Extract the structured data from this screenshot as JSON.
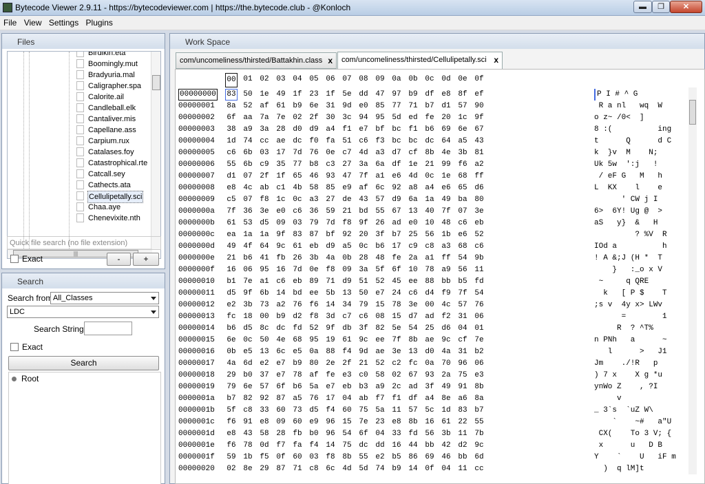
{
  "window": {
    "title": "Bytecode Viewer 2.9.11 - https://bytecodeviewer.com | https://the.bytecode.club - @Konloch",
    "min_glyph": "▬",
    "max_glyph": "❐",
    "close_glyph": "✕"
  },
  "menu": [
    "File",
    "View",
    "Settings",
    "Plugins"
  ],
  "files_panel": {
    "title": "Files",
    "items": [
      "Birdikin.eta",
      "Boomingly.mut",
      "Bradyuria.mal",
      "Caligrapher.spa",
      "Calorite.ail",
      "Candleball.elk",
      "Cantaliver.mis",
      "Capellane.ass",
      "Carpium.rux",
      "Catalases.foy",
      "Catastrophical.rte",
      "Catcall.sey",
      "Cathects.ata",
      "Cellulipetally.sci",
      "Chaa.aye",
      "Chenevixite.nth"
    ],
    "selected_index": 13,
    "hscroll_grip": "|||",
    "quick_search_placeholder": "Quick file search (no file extension)",
    "exact_label": "Exact",
    "minus_label": "-",
    "plus_label": "+"
  },
  "search_panel": {
    "title": "Search",
    "search_from_label": "Search from",
    "search_from_value": "All_Classes",
    "type_value": "LDC",
    "search_string_label": "Search String:",
    "exact_label": "Exact",
    "search_button": "Search",
    "root_label": "Root"
  },
  "workspace": {
    "title": "Work Space",
    "tabs": [
      {
        "label": "com/uncomeliness/thirsted/Battakhin.class",
        "close": "x"
      },
      {
        "label": "com/uncomeliness/thirsted/Cellulipetally.sci",
        "close": "x"
      }
    ],
    "active_tab": 1
  },
  "hex": {
    "header": [
      "00",
      "01",
      "02",
      "03",
      "04",
      "05",
      "06",
      "07",
      "08",
      "09",
      "0a",
      "0b",
      "0c",
      "0d",
      "0e",
      "0f"
    ],
    "rows": [
      {
        "off": "00000000",
        "bytes": [
          "83",
          "50",
          "1e",
          "49",
          "1f",
          "23",
          "1f",
          "5e",
          "dd",
          "47",
          "97",
          "b9",
          "df",
          "e8",
          "8f",
          "ef"
        ],
        "ascii": "P I # ^ G"
      },
      {
        "off": "00000001",
        "bytes": [
          "8a",
          "52",
          "af",
          "61",
          "b9",
          "6e",
          "31",
          "9d",
          "e0",
          "85",
          "77",
          "71",
          "b7",
          "d1",
          "57",
          "90"
        ],
        "ascii": " R a nl   wq  W"
      },
      {
        "off": "00000002",
        "bytes": [
          "6f",
          "aa",
          "7a",
          "7e",
          "02",
          "2f",
          "30",
          "3c",
          "94",
          "95",
          "5d",
          "ed",
          "fe",
          "20",
          "1c",
          "9f"
        ],
        "ascii": "o z~ /0<  ]"
      },
      {
        "off": "00000003",
        "bytes": [
          "38",
          "a9",
          "3a",
          "28",
          "d0",
          "d9",
          "a4",
          "f1",
          "e7",
          "bf",
          "bc",
          "f1",
          "b6",
          "69",
          "6e",
          "67"
        ],
        "ascii": "8 :(          ing"
      },
      {
        "off": "00000004",
        "bytes": [
          "1d",
          "74",
          "cc",
          "ae",
          "dc",
          "f0",
          "fa",
          "51",
          "c6",
          "f3",
          "bc",
          "bc",
          "dc",
          "64",
          "a5",
          "43"
        ],
        "ascii": "t      Q      d C"
      },
      {
        "off": "00000005",
        "bytes": [
          "c6",
          "6b",
          "03",
          "17",
          "7d",
          "76",
          "0e",
          "c7",
          "4d",
          "a3",
          "d7",
          "cf",
          "8b",
          "4e",
          "3b",
          "81"
        ],
        "ascii": "k  }v  M    N;"
      },
      {
        "off": "00000006",
        "bytes": [
          "55",
          "6b",
          "c9",
          "35",
          "77",
          "b8",
          "c3",
          "27",
          "3a",
          "6a",
          "df",
          "1e",
          "21",
          "99",
          "f6",
          "a2"
        ],
        "ascii": "Uk 5w  ':j   !"
      },
      {
        "off": "00000007",
        "bytes": [
          "d1",
          "07",
          "2f",
          "1f",
          "65",
          "46",
          "93",
          "47",
          "7f",
          "a1",
          "e6",
          "4d",
          "0c",
          "1e",
          "68",
          "ff"
        ],
        "ascii": " / eF G   M   h"
      },
      {
        "off": "00000008",
        "bytes": [
          "e8",
          "4c",
          "ab",
          "c1",
          "4b",
          "58",
          "85",
          "e9",
          "af",
          "6c",
          "92",
          "a8",
          "a4",
          "e6",
          "65",
          "d6"
        ],
        "ascii": "L  KX    l    e"
      },
      {
        "off": "00000009",
        "bytes": [
          "c5",
          "07",
          "f8",
          "1c",
          "0c",
          "a3",
          "27",
          "de",
          "43",
          "57",
          "d9",
          "6a",
          "1a",
          "49",
          "ba",
          "80"
        ],
        "ascii": "      ' CW j I"
      },
      {
        "off": "0000000a",
        "bytes": [
          "7f",
          "36",
          "3e",
          "e0",
          "c6",
          "36",
          "59",
          "21",
          "bd",
          "55",
          "67",
          "13",
          "40",
          "7f",
          "07",
          "3e"
        ],
        "ascii": "6>  6Y! Ug @  >"
      },
      {
        "off": "0000000b",
        "bytes": [
          "61",
          "53",
          "d5",
          "09",
          "03",
          "79",
          "7d",
          "f8",
          "9f",
          "26",
          "ad",
          "e0",
          "10",
          "48",
          "c6",
          "eb"
        ],
        "ascii": "aS   y}  &   H"
      },
      {
        "off": "0000000c",
        "bytes": [
          "ea",
          "1a",
          "1a",
          "9f",
          "83",
          "87",
          "bf",
          "92",
          "20",
          "3f",
          "b7",
          "25",
          "56",
          "1b",
          "e6",
          "52"
        ],
        "ascii": "         ? %V  R"
      },
      {
        "off": "0000000d",
        "bytes": [
          "49",
          "4f",
          "64",
          "9c",
          "61",
          "eb",
          "d9",
          "a5",
          "0c",
          "b6",
          "17",
          "c9",
          "c8",
          "a3",
          "68",
          "c6"
        ],
        "ascii": "IOd a          h"
      },
      {
        "off": "0000000e",
        "bytes": [
          "21",
          "b6",
          "41",
          "fb",
          "26",
          "3b",
          "4a",
          "0b",
          "28",
          "48",
          "fe",
          "2a",
          "a1",
          "ff",
          "54",
          "9b"
        ],
        "ascii": "! A &;J (H *  T"
      },
      {
        "off": "0000000f",
        "bytes": [
          "16",
          "06",
          "95",
          "16",
          "7d",
          "0e",
          "f8",
          "09",
          "3a",
          "5f",
          "6f",
          "10",
          "78",
          "a9",
          "56",
          "11"
        ],
        "ascii": "    }   :_o x V"
      },
      {
        "off": "00000010",
        "bytes": [
          "b1",
          "7e",
          "a1",
          "c6",
          "eb",
          "89",
          "71",
          "d9",
          "51",
          "52",
          "45",
          "ee",
          "88",
          "bb",
          "b5",
          "fd"
        ],
        "ascii": " ~     q QRE"
      },
      {
        "off": "00000011",
        "bytes": [
          "d5",
          "9f",
          "6b",
          "14",
          "bd",
          "ee",
          "5b",
          "13",
          "50",
          "e7",
          "24",
          "c6",
          "d4",
          "f9",
          "7f",
          "54"
        ],
        "ascii": "  k   [ P $    T"
      },
      {
        "off": "00000012",
        "bytes": [
          "e2",
          "3b",
          "73",
          "a2",
          "76",
          "f6",
          "14",
          "34",
          "79",
          "15",
          "78",
          "3e",
          "00",
          "4c",
          "57",
          "76"
        ],
        "ascii": ";s v  4y x> LWv"
      },
      {
        "off": "00000013",
        "bytes": [
          "fc",
          "18",
          "00",
          "b9",
          "d2",
          "f8",
          "3d",
          "c7",
          "c6",
          "08",
          "15",
          "d7",
          "ad",
          "f2",
          "31",
          "06"
        ],
        "ascii": "      =        1"
      },
      {
        "off": "00000014",
        "bytes": [
          "b6",
          "d5",
          "8c",
          "dc",
          "fd",
          "52",
          "9f",
          "db",
          "3f",
          "82",
          "5e",
          "54",
          "25",
          "d6",
          "04",
          "01"
        ],
        "ascii": "     R  ? ^T%"
      },
      {
        "off": "00000015",
        "bytes": [
          "6e",
          "0c",
          "50",
          "4e",
          "68",
          "95",
          "19",
          "61",
          "9c",
          "ee",
          "7f",
          "8b",
          "ae",
          "9c",
          "cf",
          "7e"
        ],
        "ascii": "n PNh   a      ~"
      },
      {
        "off": "00000016",
        "bytes": [
          "0b",
          "e5",
          "13",
          "6c",
          "e5",
          "0a",
          "88",
          "f4",
          "9d",
          "ae",
          "3e",
          "13",
          "d0",
          "4a",
          "31",
          "b2"
        ],
        "ascii": "   l      >   J1"
      },
      {
        "off": "00000017",
        "bytes": [
          "4a",
          "6d",
          "e2",
          "e7",
          "b9",
          "80",
          "2e",
          "2f",
          "21",
          "52",
          "c2",
          "fc",
          "0a",
          "70",
          "96",
          "06"
        ],
        "ascii": "Jm    ./!R   p"
      },
      {
        "off": "00000018",
        "bytes": [
          "29",
          "b0",
          "37",
          "e7",
          "78",
          "af",
          "fe",
          "e3",
          "c0",
          "58",
          "02",
          "67",
          "93",
          "2a",
          "75",
          "e3"
        ],
        "ascii": ") 7 x    X g *u"
      },
      {
        "off": "00000019",
        "bytes": [
          "79",
          "6e",
          "57",
          "6f",
          "b6",
          "5a",
          "e7",
          "eb",
          "b3",
          "a9",
          "2c",
          "ad",
          "3f",
          "49",
          "91",
          "8b"
        ],
        "ascii": "ynWo Z    , ?I"
      },
      {
        "off": "0000001a",
        "bytes": [
          "b7",
          "82",
          "92",
          "87",
          "a5",
          "76",
          "17",
          "04",
          "ab",
          "f7",
          "f1",
          "df",
          "a4",
          "8e",
          "a6",
          "8a"
        ],
        "ascii": "     v"
      },
      {
        "off": "0000001b",
        "bytes": [
          "5f",
          "c8",
          "33",
          "60",
          "73",
          "d5",
          "f4",
          "60",
          "75",
          "5a",
          "11",
          "57",
          "5c",
          "1d",
          "83",
          "b7"
        ],
        "ascii": "_ 3`s  `uZ W\\"
      },
      {
        "off": "0000001c",
        "bytes": [
          "f6",
          "91",
          "e8",
          "09",
          "60",
          "e9",
          "96",
          "15",
          "7e",
          "23",
          "e8",
          "8b",
          "16",
          "61",
          "22",
          "55"
        ],
        "ascii": "    `    ~#   a\"U"
      },
      {
        "off": "0000001d",
        "bytes": [
          "e8",
          "43",
          "58",
          "28",
          "fb",
          "b0",
          "96",
          "54",
          "6f",
          "04",
          "33",
          "fd",
          "56",
          "3b",
          "11",
          "7b"
        ],
        "ascii": " CX(    To 3 V; {"
      },
      {
        "off": "0000001e",
        "bytes": [
          "f6",
          "78",
          "0d",
          "f7",
          "fa",
          "f4",
          "14",
          "75",
          "dc",
          "dd",
          "16",
          "44",
          "bb",
          "42",
          "d2",
          "9c"
        ],
        "ascii": " x      u   D B"
      },
      {
        "off": "0000001f",
        "bytes": [
          "59",
          "1b",
          "f5",
          "0f",
          "60",
          "03",
          "f8",
          "8b",
          "55",
          "e2",
          "b5",
          "86",
          "69",
          "46",
          "bb",
          "6d"
        ],
        "ascii": "Y    `    U   iF m"
      },
      {
        "off": "00000020",
        "bytes": [
          "02",
          "8e",
          "29",
          "87",
          "71",
          "c8",
          "6c",
          "4d",
          "5d",
          "74",
          "b9",
          "14",
          "0f",
          "04",
          "11",
          "cc"
        ],
        "ascii": "  )  q lM]t"
      }
    ]
  }
}
